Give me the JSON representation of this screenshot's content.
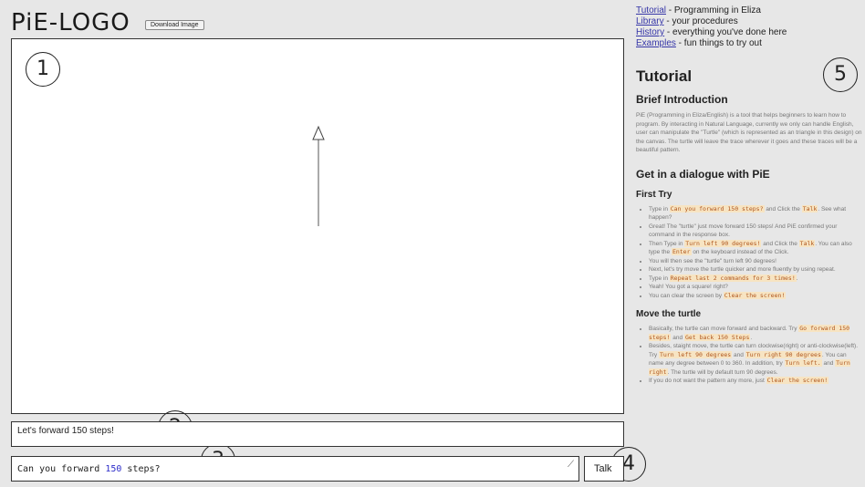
{
  "header": {
    "logo": "PiE-LOGO",
    "download_label": "Download Image"
  },
  "annotations": [
    "1",
    "2",
    "3",
    "4",
    "5"
  ],
  "response_text": "Let's forward 150  steps!",
  "input": {
    "prefix": "Can you forward ",
    "number": "150",
    "suffix": " steps?"
  },
  "talk_label": "Talk",
  "sidebar": {
    "nav": [
      {
        "link": "Tutorial",
        "desc": " - Programming in Eliza"
      },
      {
        "link": "Library",
        "desc": " - your procedures"
      },
      {
        "link": "History",
        "desc": " - everything you've done here"
      },
      {
        "link": "Examples",
        "desc": " - fun things to try out"
      }
    ],
    "title": "Tutorial",
    "brief_heading": "Brief Introduction",
    "brief_text": "PiE (Programming in Eliza/English) is a tool that helps beginners to learn how to program. By interacting in Natural Language, currently we only can handle English, user can manipulate the \"Turtle\" (which is represented as an triangle in this design) on the canvas. The turtle will leave the trace wherever it goes and these traces will be a beautiful pattern.",
    "dialogue_heading": "Get in a dialogue with PiE",
    "first_try_heading": "First Try",
    "first_try": [
      [
        "Type in ",
        {
          "code": "Can you forward 150 steps?"
        },
        " and Click the ",
        {
          "code": "Talk"
        },
        ". See what happen?"
      ],
      [
        "Great! The \"turtle\" just move forward 150 steps! And PiE confirmed your command in the response box."
      ],
      [
        "Then Type in ",
        {
          "code": "Turn left 90 degrees!"
        },
        " and Click the ",
        {
          "code": "Talk"
        },
        ". You can also type the ",
        {
          "code": "Enter"
        },
        " on the keyboard instead of the Click."
      ],
      [
        "You will then see the \"turtle\" turn left 90 degrees!"
      ],
      [
        "Next, let's try move the turtle quicker and more fluently by using repeat."
      ],
      [
        "Type in ",
        {
          "code": "Repeat last 2 commands for 3 times!"
        },
        "."
      ],
      [
        "Yeah! You got a square! right?"
      ],
      [
        "You can clear the screen by ",
        {
          "code": "Clear the screen!"
        }
      ]
    ],
    "move_heading": "Move the turtle",
    "move_items": [
      [
        "Basically, the turtle can move forward and backward. Try ",
        {
          "code": "Go forward 150 steps!"
        },
        " and ",
        {
          "code": "Get back 150 Steps"
        },
        "."
      ],
      [
        "Besides, staight move, the turtle can turn clockwise(right) or anti-clockwise(left). Try ",
        {
          "code": "Turn left 90 degrees"
        },
        " and ",
        {
          "code": "Turn right 90 degrees"
        },
        ". You can name any degree between 0 to 360. In addition, try ",
        {
          "code": "Turn left."
        },
        " and ",
        {
          "code": "Turn right"
        },
        ". The turtle will by default turn 90 degrees."
      ],
      [
        "If you do not want the pattern any more, just ",
        {
          "code": "Clear the screen!"
        }
      ]
    ]
  }
}
